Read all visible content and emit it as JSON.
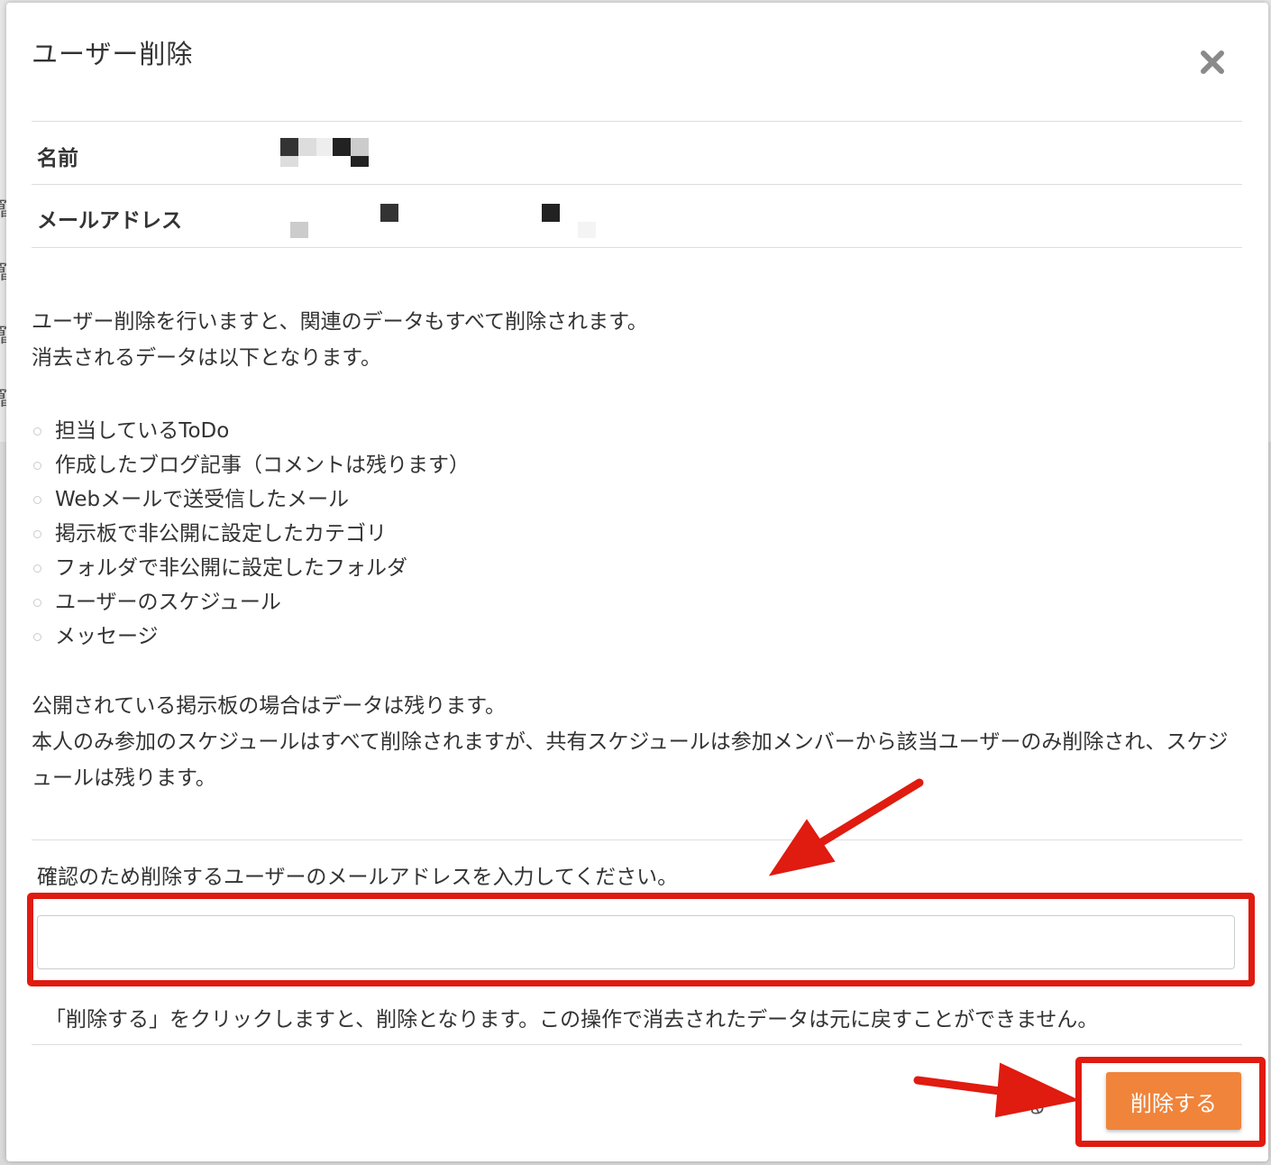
{
  "dialog": {
    "title": "ユーザー削除",
    "close_icon": "close-icon"
  },
  "user_info": {
    "name_label": "名前",
    "email_label": "メールアドレス"
  },
  "description": {
    "line1": "ユーザー削除を行いますと、関連のデータもすべて削除されます。",
    "line2": "消去されるデータは以下となります。",
    "items": [
      "担当しているToDo",
      "作成したブログ記事（コメントは残ります）",
      "Webメールで送受信したメール",
      "掲示板で非公開に設定したカテゴリ",
      "フォルダで非公開に設定したフォルダ",
      "ユーザーのスケジュール",
      "メッセージ"
    ],
    "note1": "公開されている掲示板の場合はデータは残ります。",
    "note2": "本人のみ参加のスケジュールはすべて削除されますが、共有スケジュールは参加メンバーから該当ユーザーのみ削除され、スケジュールは残ります。"
  },
  "confirm": {
    "label": "確認のため削除するユーザーのメールアドレスを入力してください。",
    "input_value": "",
    "warning": "「削除する」をクリックしますと、削除となります。この操作で消去されたデータは元に戻すことができません。"
  },
  "footer": {
    "close_label": "る",
    "delete_label": "削除する"
  },
  "colors": {
    "annotation_red": "#e01b10",
    "delete_button": "#f0843a"
  }
}
